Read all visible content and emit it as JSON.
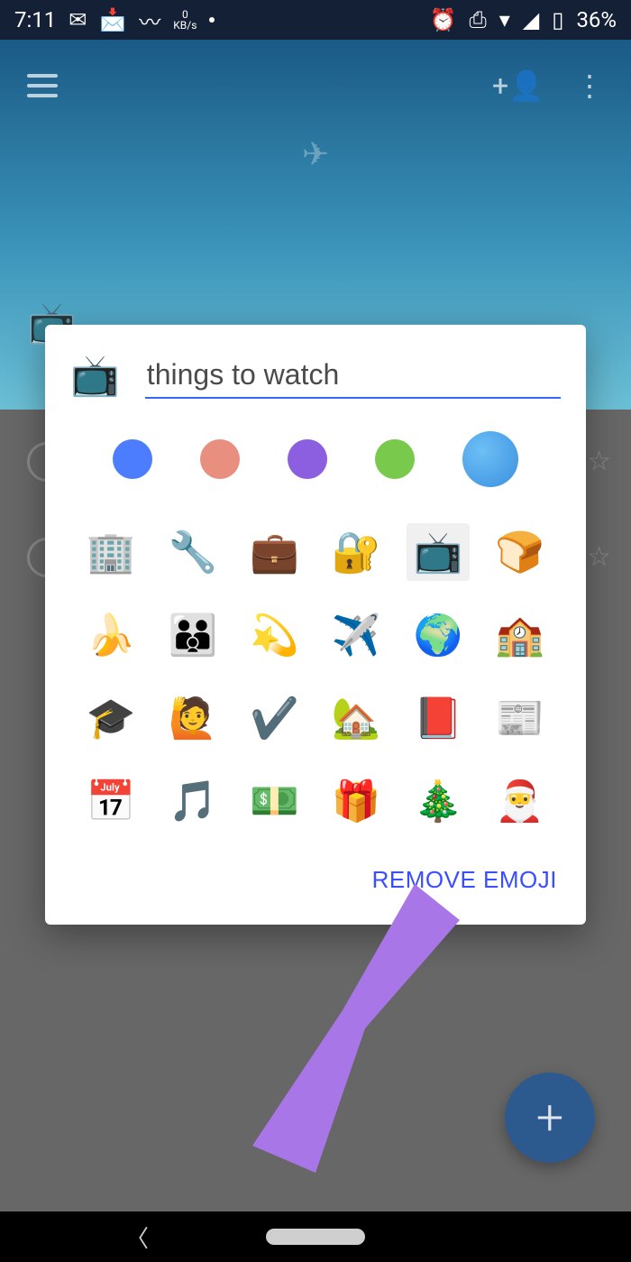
{
  "statusbar": {
    "time": "7:11",
    "kbs_value": "0",
    "kbs_unit": "KB/s",
    "battery_pct": "36%"
  },
  "background": {
    "title_emoji": "📺",
    "title_text": "things to watch"
  },
  "dialog": {
    "current_emoji": "📺",
    "name_value": "things to watch",
    "colors": [
      "#4d7dff",
      "#e98f80",
      "#8b5fe0",
      "#79c94c",
      "#3a8fe0"
    ],
    "emojis": [
      {
        "name": "building",
        "char": "🏢"
      },
      {
        "name": "wrench",
        "char": "🔧"
      },
      {
        "name": "briefcase",
        "char": "💼"
      },
      {
        "name": "locked-key",
        "char": "🔐"
      },
      {
        "name": "tv",
        "char": "📺",
        "selected": true
      },
      {
        "name": "bread",
        "char": "🍞"
      },
      {
        "name": "banana",
        "char": "🍌"
      },
      {
        "name": "family",
        "char": "👪"
      },
      {
        "name": "dizzy",
        "char": "💫"
      },
      {
        "name": "airplane",
        "char": "✈️"
      },
      {
        "name": "globe",
        "char": "🌍"
      },
      {
        "name": "school",
        "char": "🏫"
      },
      {
        "name": "grad-cap",
        "char": "🎓"
      },
      {
        "name": "raising-hand",
        "char": "🙋"
      },
      {
        "name": "check",
        "char": "✔️"
      },
      {
        "name": "house-garden",
        "char": "🏡"
      },
      {
        "name": "notebook",
        "char": "📕"
      },
      {
        "name": "newspaper",
        "char": "📰"
      },
      {
        "name": "calendar",
        "char": "📅"
      },
      {
        "name": "music-note",
        "char": "🎵"
      },
      {
        "name": "money",
        "char": "💵"
      },
      {
        "name": "gift",
        "char": "🎁"
      },
      {
        "name": "xmas-tree",
        "char": "🎄"
      },
      {
        "name": "santa",
        "char": "🎅"
      }
    ],
    "remove_label": "REMOVE EMOJI"
  },
  "fab": {
    "label": "+"
  }
}
